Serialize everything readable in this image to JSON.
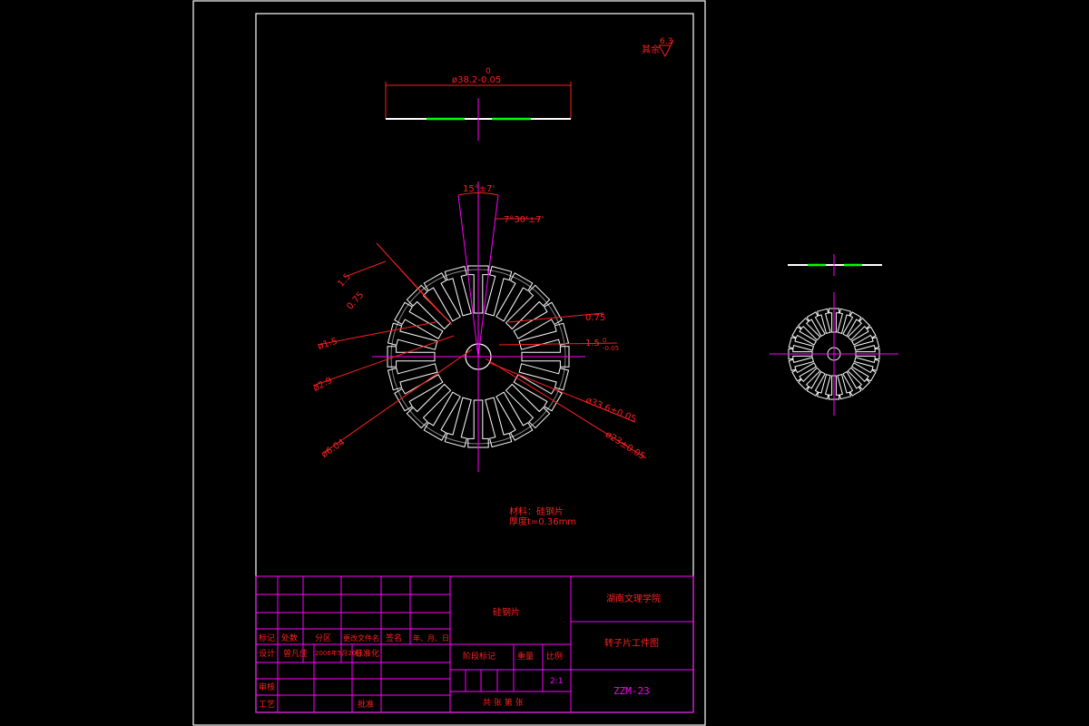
{
  "colors": {
    "background": "#000000",
    "frame": "#ffffff",
    "center_lines": "#ff00ff",
    "dimensions": "#ff2020",
    "highlight": "#00ff00"
  },
  "roughness": {
    "label": "其余",
    "value": "6.3"
  },
  "top_dimension": {
    "label": "ø38.2-0.05",
    "upper_tol": "0"
  },
  "angle_dims": {
    "slot_pitch": "15°±7'",
    "half_pitch": "7°30'±7'"
  },
  "left_dims": {
    "d1": "1.5",
    "d2": "0.75",
    "d3": "ø1.5",
    "d4": "ø2.9",
    "d5": "ø6.04"
  },
  "right_dims": {
    "d1": "0.75",
    "d2": "1.5",
    "d2_tol": "0",
    "d2_tol_low": "-0.05",
    "d3": "ø33.6±0.05",
    "d4": "ø23±0.05"
  },
  "notes": {
    "material": "材料：硅钢片",
    "thickness": "厚度t=0.36mm"
  },
  "title_block": {
    "part_name": "硅钢片",
    "school": "湖南文理学院",
    "drawing_title": "转子片工件图",
    "drawing_no": "ZZM-23",
    "scale_value": "2:1",
    "header_labels": [
      "标记",
      "处数",
      "分区",
      "更改文件名",
      "签名",
      "年、月、日"
    ],
    "design_label": "设计",
    "designer": "曾凡佳",
    "design_date": "2006年5月20日",
    "standard_label": "标准化",
    "review_label": "审核",
    "process_label": "工艺",
    "approve_label": "批准",
    "stage_label": "阶段标记",
    "weight_label": "重量",
    "scale_label": "比例",
    "sheet_label": "共   张   第   张"
  }
}
